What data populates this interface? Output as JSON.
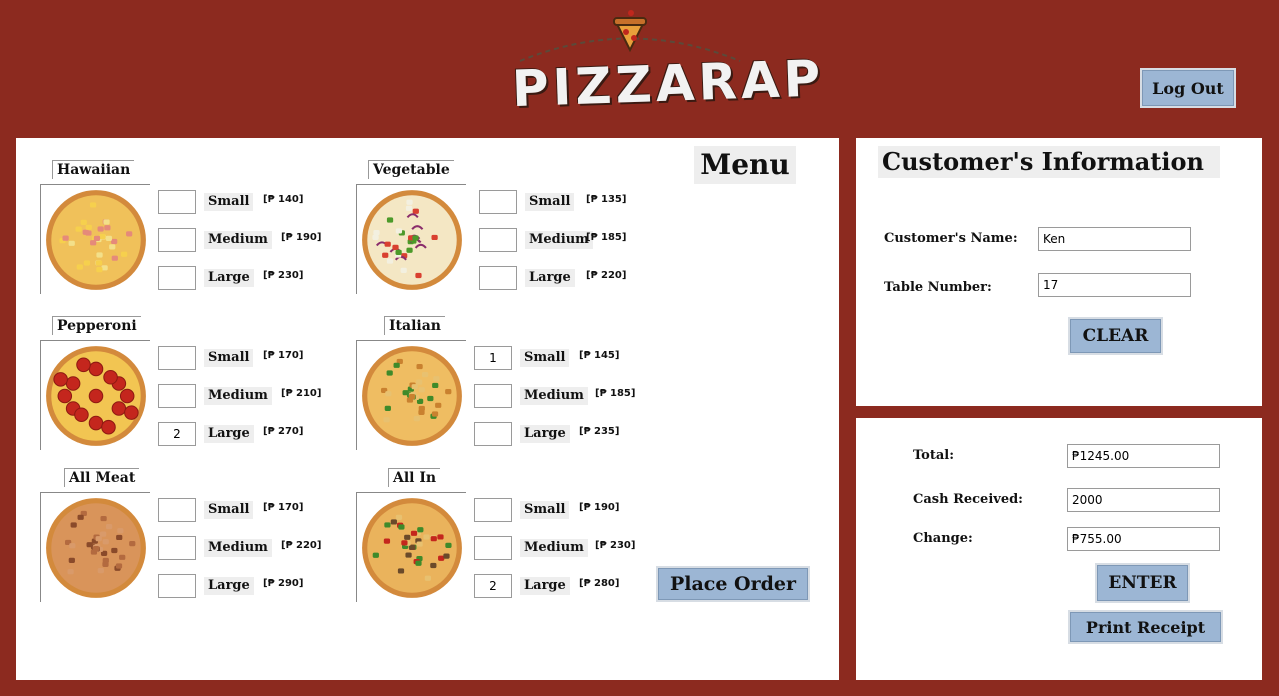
{
  "brand": {
    "logo_text": "PIZZARAP"
  },
  "header": {
    "logout_label": "Log Out"
  },
  "menu": {
    "title": "Menu",
    "place_order_label": "Place Order",
    "pizzas": [
      {
        "name": "Hawaiian",
        "sizes": [
          {
            "label": "Small",
            "price": "[₱ 140]",
            "qty": ""
          },
          {
            "label": "Medium",
            "price": "[₱ 190]",
            "qty": ""
          },
          {
            "label": "Large",
            "price": "[₱ 230]",
            "qty": ""
          }
        ]
      },
      {
        "name": "Vegetable",
        "sizes": [
          {
            "label": "Small",
            "price": "[₱ 135]",
            "qty": ""
          },
          {
            "label": "Medium",
            "price": "[₱ 185]",
            "qty": ""
          },
          {
            "label": "Large",
            "price": "[₱ 220]",
            "qty": ""
          }
        ]
      },
      {
        "name": "Pepperoni",
        "sizes": [
          {
            "label": "Small",
            "price": "[₱ 170]",
            "qty": ""
          },
          {
            "label": "Medium",
            "price": "[₱ 210]",
            "qty": ""
          },
          {
            "label": "Large",
            "price": "[₱ 270]",
            "qty": "2"
          }
        ]
      },
      {
        "name": "Italian",
        "sizes": [
          {
            "label": "Small",
            "price": "[₱ 145]",
            "qty": "1"
          },
          {
            "label": "Medium",
            "price": "[₱ 185]",
            "qty": ""
          },
          {
            "label": "Large",
            "price": "[₱ 235]",
            "qty": ""
          }
        ]
      },
      {
        "name": "All Meat",
        "sizes": [
          {
            "label": "Small",
            "price": "[₱ 170]",
            "qty": ""
          },
          {
            "label": "Medium",
            "price": "[₱ 220]",
            "qty": ""
          },
          {
            "label": "Large",
            "price": "[₱ 290]",
            "qty": ""
          }
        ]
      },
      {
        "name": "All In",
        "sizes": [
          {
            "label": "Small",
            "price": "[₱ 190]",
            "qty": ""
          },
          {
            "label": "Medium",
            "price": "[₱ 230]",
            "qty": ""
          },
          {
            "label": "Large",
            "price": "[₱ 280]",
            "qty": "2"
          }
        ]
      }
    ]
  },
  "customer": {
    "title": "Customer's Information",
    "name_label": "Customer's Name:",
    "name_value": "Ken",
    "table_label": "Table Number:",
    "table_value": "17",
    "clear_label": "CLEAR"
  },
  "payment": {
    "total_label": "Total:",
    "total_value": "₱1245.00",
    "cash_label": "Cash Received:",
    "cash_value": "2000",
    "change_label": "Change:",
    "change_value": "₱755.00",
    "enter_label": "ENTER",
    "print_label": "Print Receipt"
  },
  "colors": {
    "background": "#8c2a1f",
    "button": "#9cb6d4",
    "panel": "#ffffff"
  },
  "icons": [
    "pizza-slice-icon",
    "hawaiian-pizza-image",
    "vegetable-pizza-image",
    "pepperoni-pizza-image",
    "italian-pizza-image",
    "all-meat-pizza-image",
    "all-in-pizza-image"
  ]
}
